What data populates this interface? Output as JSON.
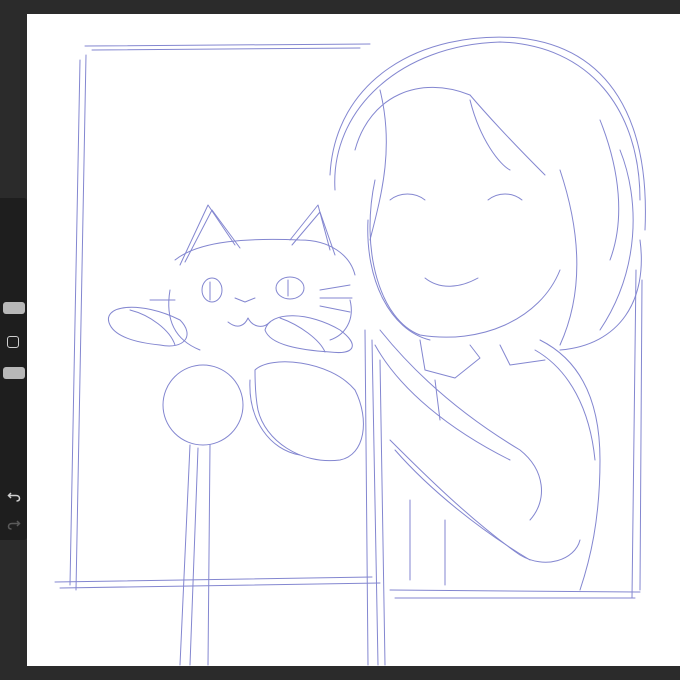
{
  "app": {
    "canvas_background": "#ffffff",
    "workspace_background": "#2b2b2b",
    "sketch_color": "#6e72c8"
  },
  "sidebar": {
    "brush_size_slider": {
      "level": 0.5
    },
    "brush_opacity_slider": {
      "level": 0.5
    },
    "icons": {
      "modify": "square-outline-icon",
      "undo": "undo-arrow-icon",
      "redo": "redo-arrow-icon"
    },
    "redo_enabled": false
  }
}
